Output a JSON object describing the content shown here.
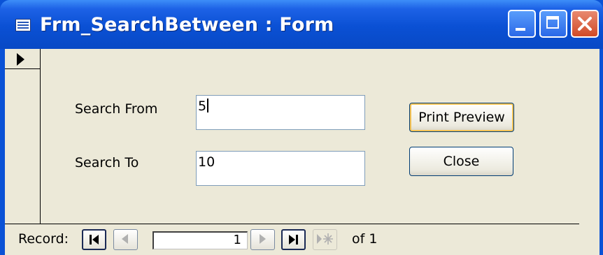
{
  "window": {
    "title": "Frm_SearchBetween : Form",
    "controls": [
      "minimize-icon",
      "maximize-icon",
      "close-icon"
    ]
  },
  "form": {
    "search_from_label": "Search From",
    "search_from_value": "5",
    "search_to_label": "Search To",
    "search_to_value": "10",
    "print_preview_label": "Print Preview",
    "close_label": "Close"
  },
  "navigation": {
    "record_label": "Record:",
    "current_record": "1",
    "of_text": "of 1"
  },
  "colors": {
    "titlebar": "#0a50d4",
    "client_background": "#ece9d8",
    "close_button": "#d04a26"
  }
}
